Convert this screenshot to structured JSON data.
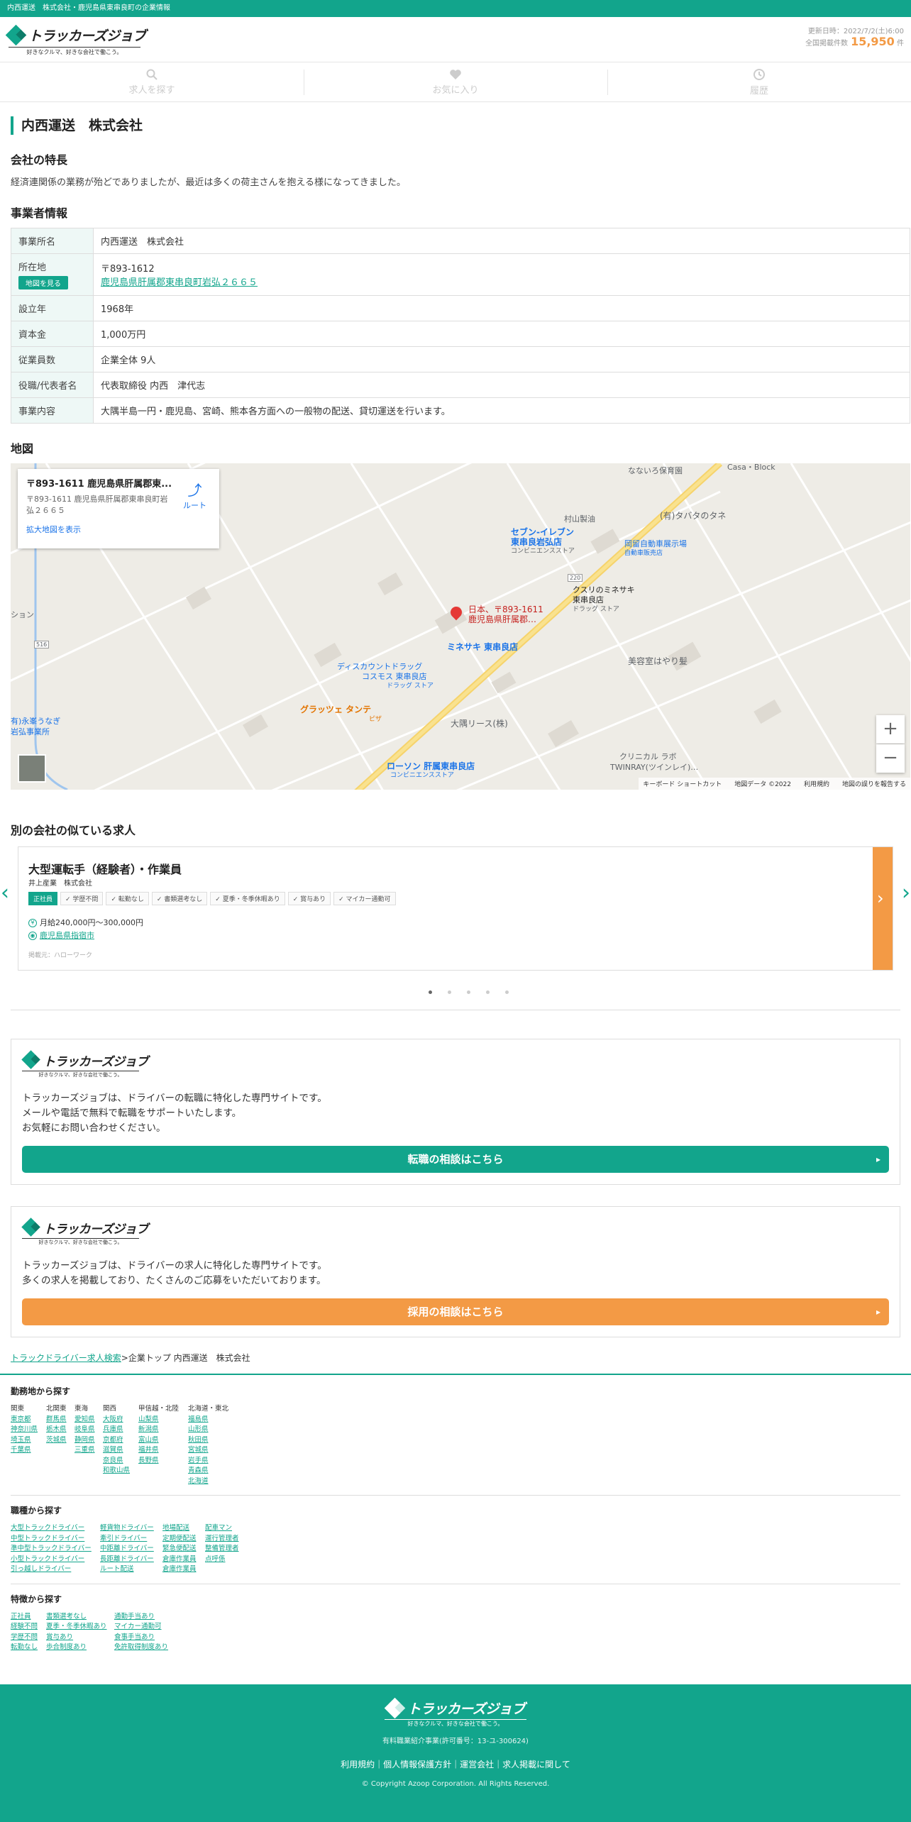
{
  "topbar": {
    "text": "内西運送　株式会社・鹿児島県東串良町の企業情報"
  },
  "header": {
    "logo_text": "トラッカーズジョブ",
    "logo_sub": "好きなクルマ、好きな会社で働こう。",
    "updated": "更新日時：2022/7/2(土)6:00",
    "count_label": "全国掲載件数",
    "count": "15,950",
    "count_unit": "件"
  },
  "nav": {
    "search": "求人を探す",
    "favorite": "お気に入り",
    "history": "履歴"
  },
  "company": {
    "title": "内西運送　株式会社",
    "feature_heading": "会社の特長",
    "feature_text": "経済連関係の業務が殆どでありましたが、最近は多くの荷主さんを抱える様になってきました。",
    "info_heading": "事業者情報",
    "rows": [
      {
        "k": "事業所名",
        "v": "内西運送　株式会社"
      },
      {
        "k": "所在地",
        "map_btn": "地図を見る",
        "zip": "〒893-1612",
        "addr": "鹿児島県肝属郡東串良町岩弘２６６５"
      },
      {
        "k": "設立年",
        "v": "1968年"
      },
      {
        "k": "資本金",
        "v": "1,000万円"
      },
      {
        "k": "従業員数",
        "v": "企業全体 9人"
      },
      {
        "k": "役職/代表者名",
        "v": "代表取締役 内西　津代志"
      },
      {
        "k": "事業内容",
        "v": "大隅半島一円・鹿児島、宮崎、熊本各方面への一般物の配送、貸切運送を行います。"
      }
    ]
  },
  "map": {
    "heading": "地図",
    "card_title": "〒893-1611 鹿児島県肝属郡東...",
    "card_addr": "〒893-1611 鹿児島県肝属郡東串良町岩弘２６６５",
    "card_route": "ルート",
    "card_expand": "拡大地図を表示",
    "pin_label1": "日本、〒893-1611",
    "pin_label2": "鹿児島県肝属郡…",
    "places": {
      "p1": "なないろ保育園",
      "p2": "Casa・Block",
      "p3": "村山製油",
      "p4": "(有)タバタのタネ",
      "p5": "セブン-イレブン",
      "p5b": "東串良岩弘店",
      "p5c": "コンビニエンスストア",
      "p6": "岡留自動車展示場",
      "p6b": "自動車販売店",
      "p7": "クスリのミネサキ",
      "p7b": "東串良店",
      "p7c": "ドラッグ ストア",
      "p8": "ミネサキ 東串良店",
      "p9": "美容室はやり髪",
      "p10": "ディスカウントドラッグ",
      "p10b": "コスモス 東串良店",
      "p10c": "ドラッグ ストア",
      "p11": "グラッツェ タンテ",
      "p11b": "ピザ",
      "p12": "大隅リース(株)",
      "p13": "ローソン 肝属東串良店",
      "p13b": "コンビニエンスストア",
      "p14": "クリニカル ラボ",
      "p14b": "TWINRAY(ツインレイ)…",
      "p15": "有)永峯うなぎ",
      "p15b": "岩弘事業所",
      "p16": "ション",
      "road1": "220",
      "road2": "516"
    },
    "zoom_in": "+",
    "zoom_out": "−",
    "footer": "キーボード ショートカット　　地図データ ©2022　　利用規約　　地図の誤りを報告する"
  },
  "similar": {
    "heading": "別の会社の似ている求人",
    "title": "大型運転手（経験者）・作業員",
    "company": "井上産業　株式会社",
    "tags": [
      "正社員",
      "学歴不問",
      "転勤なし",
      "書類選考なし",
      "夏季・冬季休暇あり",
      "賞与あり",
      "マイカー通勤可"
    ],
    "salary": "月給240,000円〜300,000円",
    "location": "鹿児島県指宿市",
    "source": "掲載元：ハローワーク"
  },
  "promo1": {
    "text1": "トラッカーズジョブは、ドライバーの転職に特化した専門サイトです。",
    "text2": "メールや電話で無料で転職をサポートいたします。",
    "text3": "お気軽にお問い合わせください。",
    "button": "転職の相談はこちら",
    "color": "#12a58c"
  },
  "promo2": {
    "text1": "トラッカーズジョブは、ドライバーの求人に特化した専門サイトです。",
    "text2": "多くの求人を掲載しており、たくさんのご応募をいただいております。",
    "button": "採用の相談はこちら",
    "color": "#f39a45"
  },
  "breadcrumb": {
    "link": "トラックドライバー求人検索",
    "rest": ">企業トップ 内西運送　株式会社"
  },
  "footnav": {
    "area_heading": "勤務地から探す",
    "areas": [
      {
        "h": "関東",
        "items": [
          "東京都",
          "神奈川県",
          "埼玉県",
          "千葉県"
        ]
      },
      {
        "h": "北関東",
        "items": [
          "群馬県",
          "栃木県",
          "茨城県"
        ]
      },
      {
        "h": "東海",
        "items": [
          "愛知県",
          "岐阜県",
          "静岡県",
          "三重県"
        ]
      },
      {
        "h": "関西",
        "items": [
          "大阪府",
          "兵庫県",
          "京都府",
          "滋賀県",
          "奈良県",
          "和歌山県"
        ]
      },
      {
        "h": "甲信越・北陸",
        "items": [
          "山梨県",
          "新潟県",
          "富山県",
          "福井県",
          "長野県"
        ]
      },
      {
        "h": "北海道・東北",
        "items": [
          "福島県",
          "山形県",
          "秋田県",
          "宮城県",
          "岩手県",
          "青森県",
          "北海道"
        ]
      }
    ],
    "job_heading": "職種から探す",
    "jobs": [
      [
        "大型トラックドライバー",
        "中型トラックドライバー",
        "準中型トラックドライバー",
        "小型トラックドライバー",
        "引っ越しドライバー"
      ],
      [
        "軽貨物ドライバー",
        "牽引ドライバー",
        "中距離ドライバー",
        "長距離ドライバー",
        "ルート配送"
      ],
      [
        "地場配送",
        "定期便配送",
        "緊急便配送",
        "倉庫作業員",
        "倉庫作業員"
      ],
      [
        "配車マン",
        "運行管理者",
        "整備管理者",
        "点呼係"
      ]
    ],
    "feat_heading": "特徴から探す",
    "feats": [
      [
        "正社員",
        "経験不問",
        "学歴不問",
        "転勤なし"
      ],
      [
        "書類選考なし",
        "夏季・冬季休暇あり",
        "賞与あり",
        "歩合制度あり"
      ],
      [
        "通勤手当あり",
        "マイカー通勤可",
        "食事手当あり",
        "免許取得制度あり"
      ]
    ]
  },
  "footer": {
    "license": "有料職業紹介事業(許可番号：13-ユ-300624)",
    "links": "利用規約｜個人情報保護方針｜運営会社｜求人掲載に関して",
    "copy": "© Copyright Azoop Corporation. All Rights Reserved."
  }
}
